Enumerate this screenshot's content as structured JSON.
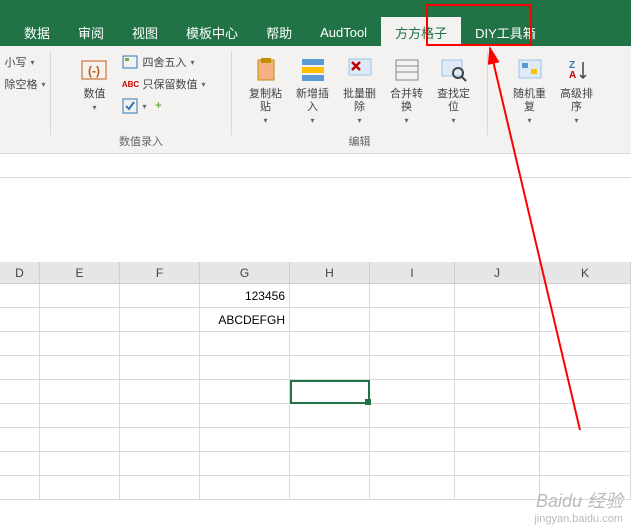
{
  "tabs": {
    "items": [
      "数据",
      "审阅",
      "视图",
      "模板中心",
      "帮助",
      "AudTool",
      "方方格子",
      "DIY工具箱"
    ],
    "active_index": 6
  },
  "ribbon": {
    "group1": {
      "item_a": "小写",
      "item_b": "除空格",
      "dd": "▾"
    },
    "group_numeric": {
      "label": "数值录入",
      "big": "数值",
      "item1": "四舍五入",
      "item2": "只保留数值",
      "abc": "ABC"
    },
    "group_edit": {
      "label": "编辑",
      "paste": "复制粘\n贴",
      "insert": "新增插\n入",
      "batchdel": "批量删\n除",
      "merge": "合并转\n换",
      "find": "查找定\n位"
    },
    "group_other": {
      "rand": "随机重\n复",
      "sort": "高级排\n序"
    }
  },
  "columns": [
    "D",
    "E",
    "F",
    "G",
    "H",
    "I",
    "J",
    "K"
  ],
  "cells": {
    "G_row1": "123456",
    "G_row2": "ABCDEFGH"
  },
  "watermark": {
    "brand": "Baidu 经验",
    "url": "jingyan.baidu.com"
  }
}
